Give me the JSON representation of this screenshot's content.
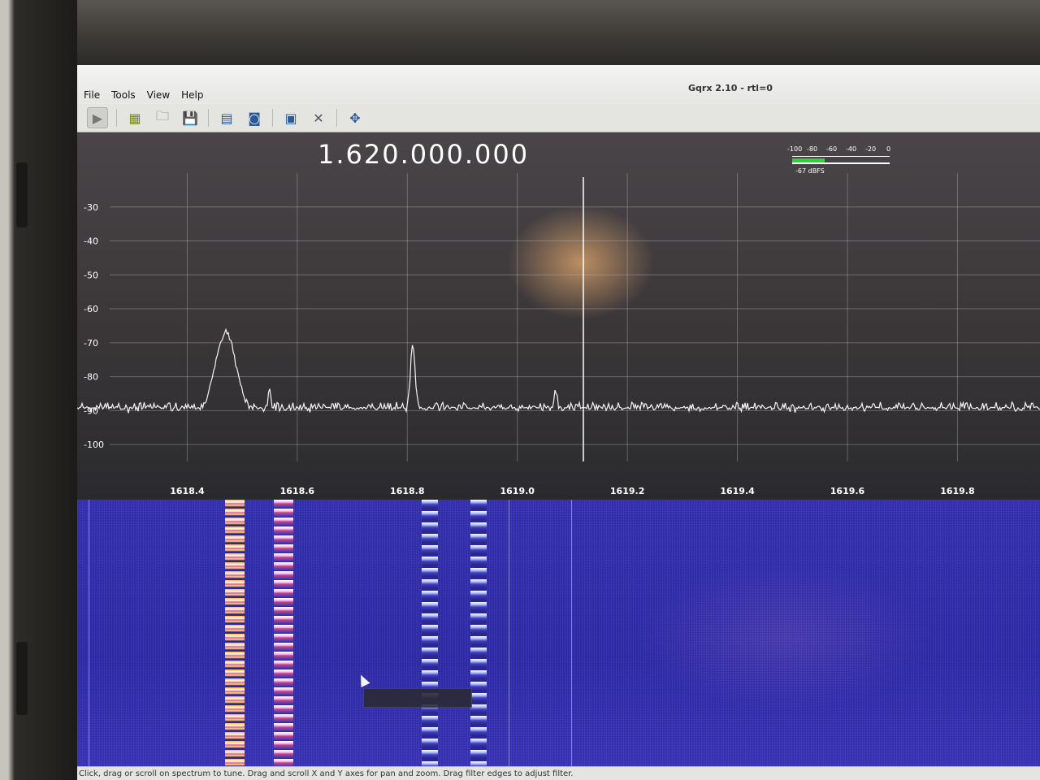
{
  "window": {
    "title": "Gqrx 2.10 - rtl=0"
  },
  "menu": [
    "File",
    "Tools",
    "View",
    "Help"
  ],
  "toolbar": [
    {
      "name": "start-dsp-icon",
      "glyph": "▶"
    },
    {
      "name": "device-config-icon",
      "glyph": "▦"
    },
    {
      "name": "open-file-icon",
      "glyph": "🗀"
    },
    {
      "name": "save-icon",
      "glyph": "💾"
    },
    {
      "name": "bookmarks-icon",
      "glyph": "▤"
    },
    {
      "name": "fft-settings-icon",
      "glyph": "◙"
    },
    {
      "name": "remote-control-icon",
      "glyph": "▣"
    },
    {
      "name": "settings-icon",
      "glyph": "✕"
    },
    {
      "name": "adjust-view-icon",
      "glyph": "✥"
    }
  ],
  "frequency": "1.620.000.000",
  "meter": {
    "scale": [
      "-100",
      "-80",
      "-60",
      "-40",
      "-20",
      "0"
    ],
    "value_label": "-67 dBFS",
    "level": -67
  },
  "chart_data": {
    "type": "line",
    "x_ticks": [
      "1618.4",
      "1618.6",
      "1618.8",
      "1619.0",
      "1619.2",
      "1619.4",
      "1619.6",
      "1619.8"
    ],
    "x_tick_values": [
      1618.4,
      1618.6,
      1618.8,
      1619.0,
      1619.2,
      1619.4,
      1619.6,
      1619.8
    ],
    "y_ticks": [
      "-30",
      "-40",
      "-50",
      "-60",
      "-70",
      "-80",
      "-90",
      "-100"
    ],
    "y_tick_values": [
      -30,
      -40,
      -50,
      -60,
      -70,
      -80,
      -90,
      -100
    ],
    "xlim": [
      1618.2,
      1619.95
    ],
    "ylim": [
      -105,
      -20
    ],
    "noise_floor": -90,
    "peaks": [
      {
        "x": 1618.47,
        "y": -67
      },
      {
        "x": 1618.55,
        "y": -84
      },
      {
        "x": 1618.81,
        "y": -70
      },
      {
        "x": 1619.07,
        "y": -84
      }
    ],
    "tuned_x": 1619.12,
    "grid": true
  },
  "status": "Click, drag or scroll on spectrum to tune. Drag and scroll X and Y axes for pan and zoom. Drag filter edges to adjust filter."
}
